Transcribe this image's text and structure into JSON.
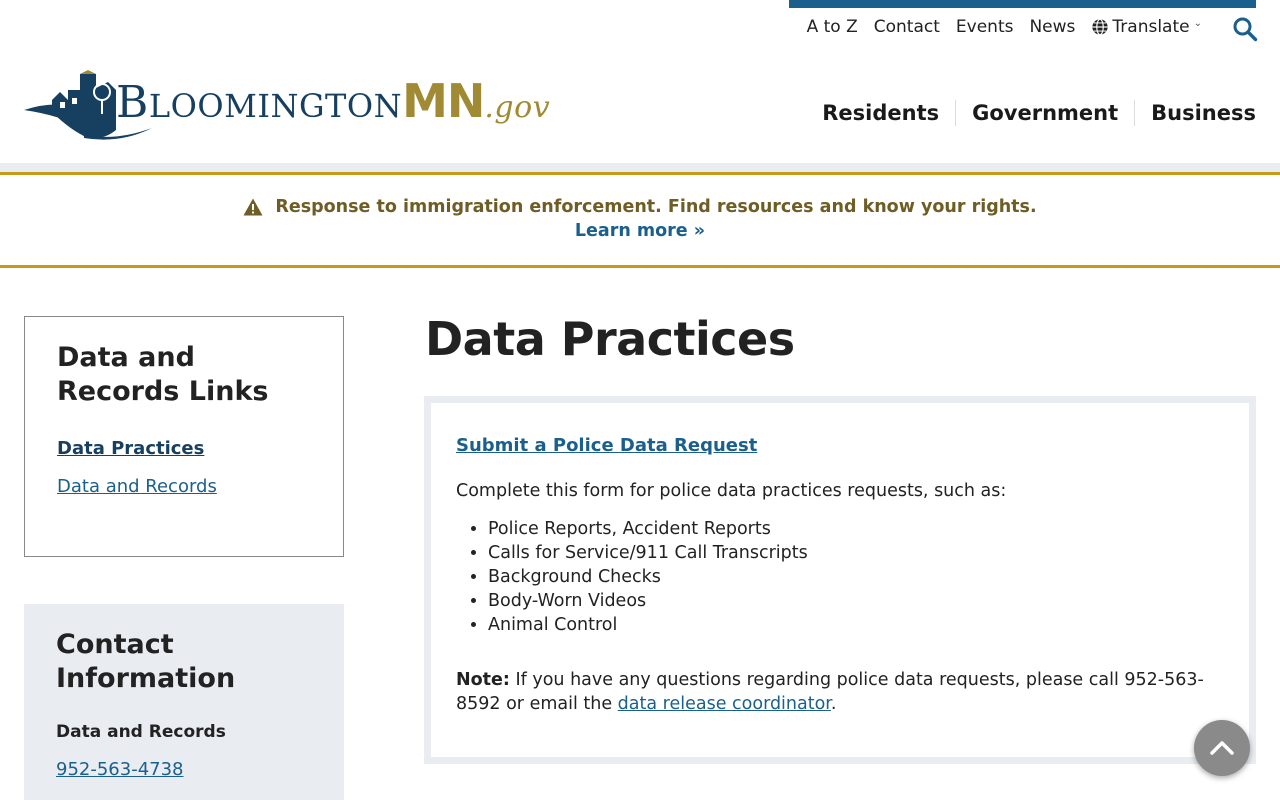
{
  "colors": {
    "navy": "#173f5f",
    "link": "#1b5f8c",
    "gold": "#c79a1a",
    "gold_text": "#6e5d24",
    "light_panel": "#e9edf2"
  },
  "utility_nav": {
    "items": [
      "A to Z",
      "Contact",
      "Events",
      "News"
    ],
    "translate_label": "Translate",
    "translate_icon": "globe-icon",
    "search_icon": "search-icon"
  },
  "logo": {
    "part1": "B",
    "part2": "LOOMINGTON",
    "part3": "MN",
    "part4": ".gov"
  },
  "main_nav": {
    "items": [
      "Residents",
      "Government",
      "Business"
    ]
  },
  "alert": {
    "icon": "warning-icon",
    "message": "Response to immigration enforcement. Find resources and know your rights.",
    "link_label": "Learn more »"
  },
  "sidebar": {
    "links_heading": "Data and Records Links",
    "links": [
      {
        "label": "Data Practices",
        "active": true
      },
      {
        "label": "Data and Records",
        "active": false
      }
    ],
    "contact_heading": "Contact Information",
    "contact_sub": "Data and Records",
    "contact_phone": "952-563-4738"
  },
  "main": {
    "title": "Data Practices",
    "request_link": "Submit a Police Data Request",
    "intro": "Complete this form for police data practices requests, such as:",
    "list": [
      "Police Reports, Accident Reports",
      "Calls for Service/911 Call Transcripts",
      "Background Checks",
      "Body-Worn Videos",
      "Animal Control"
    ],
    "note_label": "Note:",
    "note_text": " If you have any questions regarding police data requests, please call 952-563-8592 or email the ",
    "note_link": "data release coordinator",
    "note_end": "."
  },
  "back_to_top_icon": "chevron-up-icon"
}
